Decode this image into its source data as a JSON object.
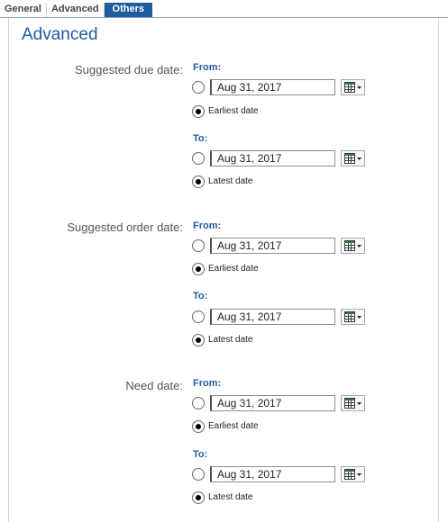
{
  "tabs": [
    {
      "label": "General",
      "active": false
    },
    {
      "label": "Advanced",
      "active": false
    },
    {
      "label": "Others",
      "active": true
    }
  ],
  "section_title": "Advanced",
  "groups": [
    {
      "label": "Suggested due date:",
      "from": {
        "label": "From:",
        "date": "Aug 31, 2017",
        "radio_label": "Earliest date",
        "radio_checked": true
      },
      "to": {
        "label": "To:",
        "date": "Aug 31, 2017",
        "radio_label": "Latest date",
        "radio_checked": true
      }
    },
    {
      "label": "Suggested order date:",
      "from": {
        "label": "From:",
        "date": "Aug 31, 2017",
        "radio_label": "Earliest date",
        "radio_checked": true
      },
      "to": {
        "label": "To:",
        "date": "Aug 31, 2017",
        "radio_label": "Latest date",
        "radio_checked": true
      }
    },
    {
      "label": "Need date:",
      "from": {
        "label": "From:",
        "date": "Aug 31, 2017",
        "radio_label": "Earliest date",
        "radio_checked": true
      },
      "to": {
        "label": "To:",
        "date": "Aug 31, 2017",
        "radio_label": "Latest date",
        "radio_checked": true
      }
    }
  ],
  "icons": {
    "calendar_button": "calendar-icon",
    "dropdown": "chevron-down-icon"
  },
  "colors": {
    "accent": "#1f5c9e",
    "active_tab_bg": "#1f5c9e"
  }
}
